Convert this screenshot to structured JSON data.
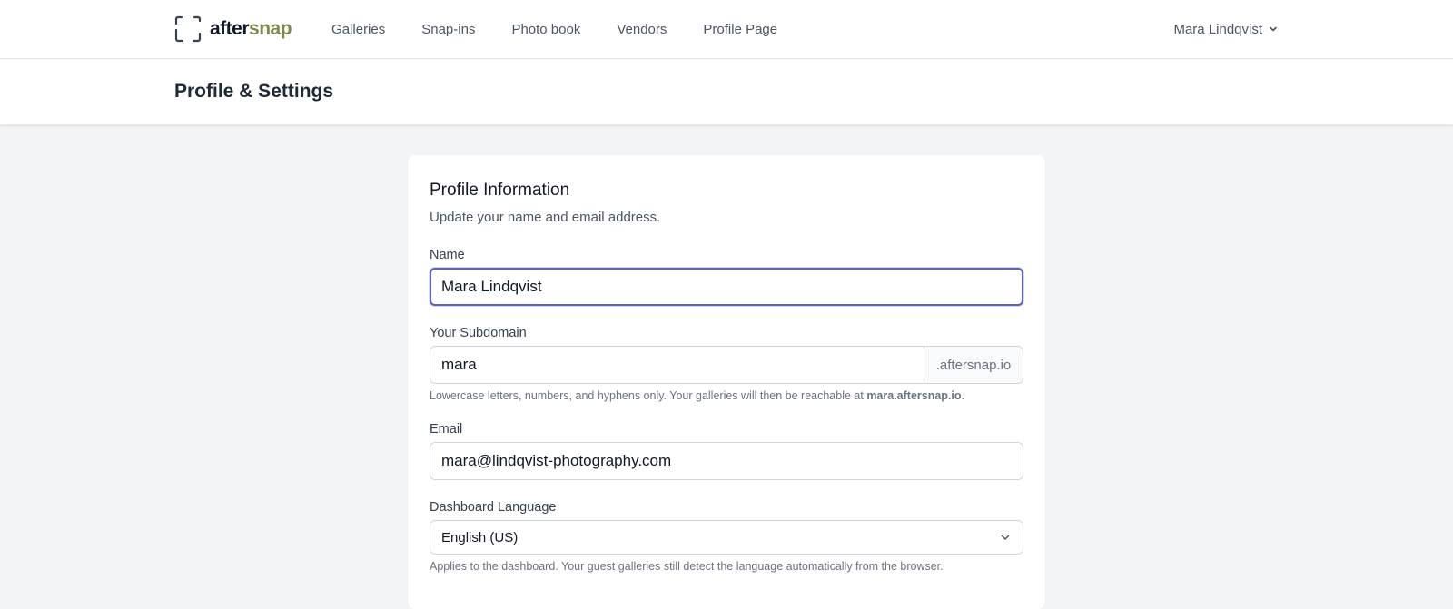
{
  "brand": {
    "name_part1": "after",
    "name_part2": "snap",
    "accent_color": "#7c8a4e"
  },
  "nav": {
    "links": [
      "Galleries",
      "Snap-ins",
      "Photo book",
      "Vendors",
      "Profile Page"
    ],
    "user_name": "Mara Lindqvist"
  },
  "header": {
    "title": "Profile & Settings"
  },
  "profile": {
    "title": "Profile Information",
    "description": "Update your name and email address.",
    "name": {
      "label": "Name",
      "value": "Mara Lindqvist"
    },
    "subdomain": {
      "label": "Your Subdomain",
      "value": "mara",
      "suffix": ".aftersnap.io",
      "help_prefix": "Lowercase letters, numbers, and hyphens only. Your galleries will then be reachable at ",
      "help_domain": "mara.aftersnap.io",
      "help_suffix": "."
    },
    "email": {
      "label": "Email",
      "value": "mara@lindqvist-photography.com"
    },
    "language": {
      "label": "Dashboard Language",
      "value": "English (US)",
      "help": "Applies to the dashboard. Your guest galleries still detect the language automatically from the browser."
    }
  },
  "colors": {
    "focus_ring": "#5b5fc7",
    "page_bg": "#f3f4f6"
  },
  "icons": {
    "logo": "viewfinder-icon",
    "user_menu": "chevron-down-icon",
    "select": "chevron-down-icon"
  }
}
